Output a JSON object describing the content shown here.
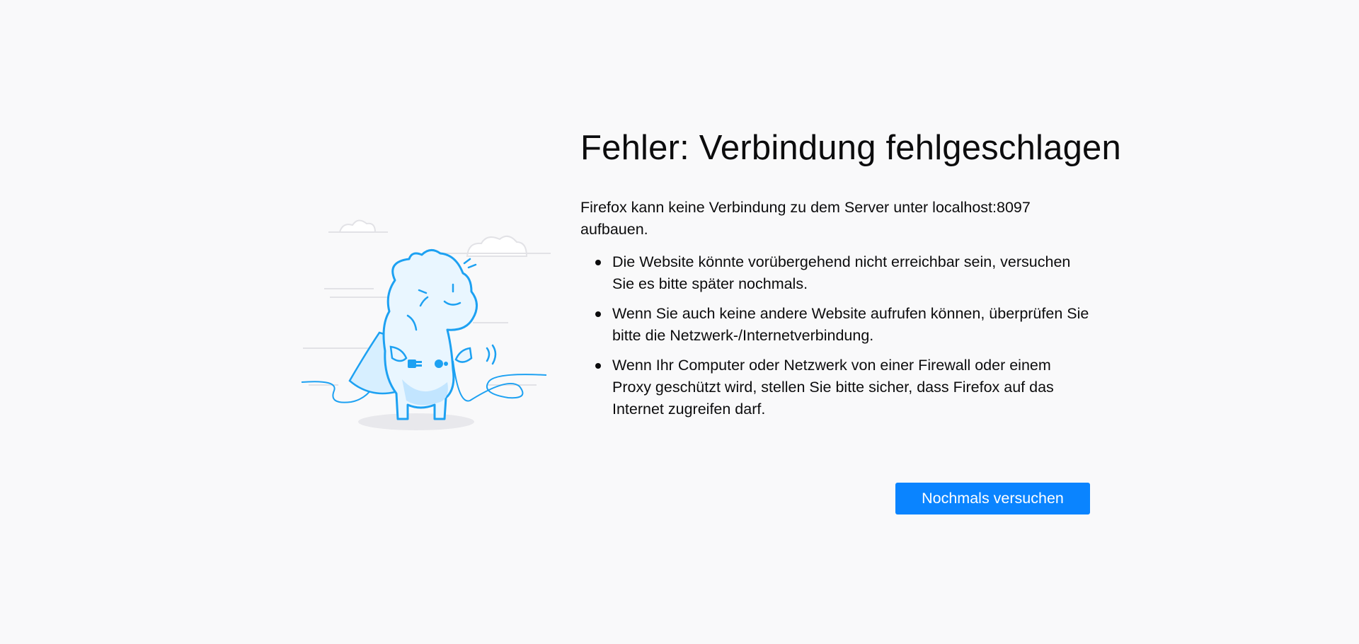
{
  "error": {
    "title": "Fehler: Verbindung fehlgeschlagen",
    "description": "Firefox kann keine Verbindung zu dem Server unter localhost:8097 aufbauen.",
    "reasons": [
      "Die Website könnte vorübergehend nicht erreichbar sein, versuchen Sie es bitte später nochmals.",
      "Wenn Sie auch keine andere Website aufrufen können, überprüfen Sie bitte die Netzwerk-/Internetverbindung.",
      "Wenn Ihr Computer oder Netzwerk von einer Firewall oder einem Proxy geschützt wird, stellen Sie bitte sicher, dass Firefox auf das Internet zugreifen darf."
    ]
  },
  "actions": {
    "retry_label": "Nochmals versuchen"
  },
  "illustration": {
    "icon": "unplugged-dino-icon"
  },
  "colors": {
    "background": "#f9f9fa",
    "accent": "#0a84ff",
    "illustration_stroke": "#1da1f2",
    "illustration_fill": "#d7efff"
  }
}
